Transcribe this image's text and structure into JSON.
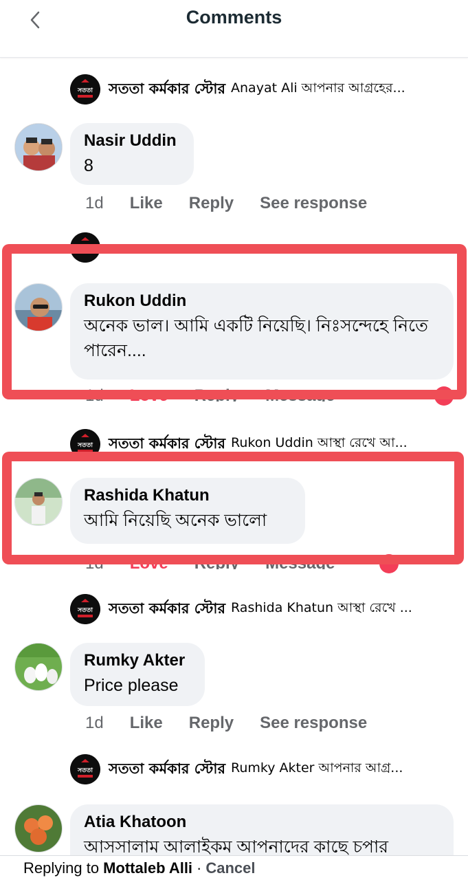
{
  "header": {
    "title": "Comments"
  },
  "page_name": "সততা কর্মকার স্টোর",
  "page_logo_text": "সততা",
  "threads": [
    {
      "reply_preview": "Anayat Ali আপনার আগ্রহের..."
    },
    {
      "name": "Nasir Uddin",
      "text": "8",
      "time": "1d",
      "actions": [
        "Like",
        "Reply",
        "See response"
      ]
    },
    {
      "name": "Rukon Uddin",
      "text": "অনেক ভাল। আমি একটি নিয়েছি। নিঃসন্দেহে নিতে পারেন....",
      "time": "1d",
      "actions": [
        "Love",
        "Reply",
        "Message"
      ]
    },
    {
      "reply_preview": "Rukon Uddin আস্থা রেখে আ..."
    },
    {
      "name": "Rashida Khatun",
      "text": "আমি নিয়েছি অনেক ভালো",
      "time": "1d",
      "actions": [
        "Love",
        "Reply",
        "Message"
      ]
    },
    {
      "reply_preview": "Rashida Khatun আস্থা রেখে ..."
    },
    {
      "name": "Rumky Akter",
      "text": "Price please",
      "time": "1d",
      "actions": [
        "Like",
        "Reply",
        "See response"
      ]
    },
    {
      "reply_preview": "Rumky Akter আপনার আগ্র..."
    },
    {
      "name": "Atia Khatoon",
      "text": "আসসালাম আলাইকম আপনাদের কাছে চপার"
    }
  ],
  "bottom_bar": {
    "prefix": "Replying to",
    "name": "Mottaleb Alli",
    "separator": "·",
    "cancel": "Cancel"
  },
  "colors": {
    "highlight": "#ef4e56",
    "love": "#f33e58",
    "bubble": "#f0f2f5",
    "meta": "#65676b"
  }
}
